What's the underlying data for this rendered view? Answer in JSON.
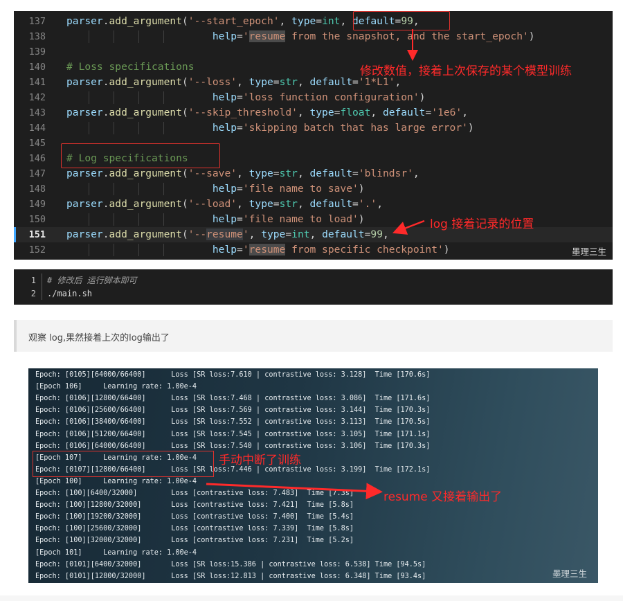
{
  "editor": {
    "lines": [
      {
        "n": "137",
        "parts": [
          [
            "tok-name",
            "parser"
          ],
          [
            "",
            "."
          ],
          [
            "tok-fn",
            "add_argument"
          ],
          [
            "",
            "("
          ],
          [
            "tok-str",
            "'--start_epoch'"
          ],
          [
            "",
            ", "
          ],
          [
            "tok-name",
            "type"
          ],
          [
            "",
            "="
          ],
          [
            "tok-type",
            "int"
          ],
          [
            "",
            ", "
          ],
          [
            "tok-name",
            "default"
          ],
          [
            "",
            "="
          ],
          [
            "tok-num",
            "99"
          ],
          [
            "",
            ","
          ]
        ]
      },
      {
        "n": "138",
        "parts": [
          [
            "",
            "                        "
          ],
          [
            "tok-name",
            "help"
          ],
          [
            "",
            "="
          ],
          [
            "tok-str",
            "'"
          ],
          [
            "tok-str tok-hl2",
            "resume"
          ],
          [
            "tok-str",
            " from the snapshot, and the start_epoch'"
          ],
          [
            "",
            ")"
          ]
        ]
      },
      {
        "n": "139",
        "parts": []
      },
      {
        "n": "140",
        "parts": [
          [
            "tok-cmt",
            "# Loss specifications"
          ]
        ]
      },
      {
        "n": "141",
        "parts": [
          [
            "tok-name",
            "parser"
          ],
          [
            "",
            "."
          ],
          [
            "tok-fn",
            "add_argument"
          ],
          [
            "",
            "("
          ],
          [
            "tok-str",
            "'--loss'"
          ],
          [
            "",
            ", "
          ],
          [
            "tok-name",
            "type"
          ],
          [
            "",
            "="
          ],
          [
            "tok-type",
            "str"
          ],
          [
            "",
            ", "
          ],
          [
            "tok-name",
            "default"
          ],
          [
            "",
            "="
          ],
          [
            "tok-str",
            "'1*L1'"
          ],
          [
            "",
            ","
          ]
        ]
      },
      {
        "n": "142",
        "parts": [
          [
            "",
            "                        "
          ],
          [
            "tok-name",
            "help"
          ],
          [
            "",
            "="
          ],
          [
            "tok-str",
            "'loss function configuration'"
          ],
          [
            "",
            ")"
          ]
        ]
      },
      {
        "n": "143",
        "parts": [
          [
            "tok-name",
            "parser"
          ],
          [
            "",
            "."
          ],
          [
            "tok-fn",
            "add_argument"
          ],
          [
            "",
            "("
          ],
          [
            "tok-str",
            "'--skip_threshold'"
          ],
          [
            "",
            ", "
          ],
          [
            "tok-name",
            "type"
          ],
          [
            "",
            "="
          ],
          [
            "tok-type",
            "float"
          ],
          [
            "",
            ", "
          ],
          [
            "tok-name",
            "default"
          ],
          [
            "",
            "="
          ],
          [
            "tok-str",
            "'1e6'"
          ],
          [
            "",
            ","
          ]
        ]
      },
      {
        "n": "144",
        "parts": [
          [
            "",
            "                        "
          ],
          [
            "tok-name",
            "help"
          ],
          [
            "",
            "="
          ],
          [
            "tok-str",
            "'skipping batch that has large error'"
          ],
          [
            "",
            ")"
          ]
        ]
      },
      {
        "n": "145",
        "parts": []
      },
      {
        "n": "146",
        "parts": [
          [
            "tok-cmt",
            "# Log specifications"
          ]
        ]
      },
      {
        "n": "147",
        "parts": [
          [
            "tok-name",
            "parser"
          ],
          [
            "",
            "."
          ],
          [
            "tok-fn",
            "add_argument"
          ],
          [
            "",
            "("
          ],
          [
            "tok-str",
            "'--save'"
          ],
          [
            "",
            ", "
          ],
          [
            "tok-name",
            "type"
          ],
          [
            "",
            "="
          ],
          [
            "tok-type",
            "str"
          ],
          [
            "",
            ", "
          ],
          [
            "tok-name",
            "default"
          ],
          [
            "",
            "="
          ],
          [
            "tok-str",
            "'blindsr'"
          ],
          [
            "",
            ","
          ]
        ]
      },
      {
        "n": "148",
        "parts": [
          [
            "",
            "                        "
          ],
          [
            "tok-name",
            "help"
          ],
          [
            "",
            "="
          ],
          [
            "tok-str",
            "'file name to save'"
          ],
          [
            "",
            ")"
          ]
        ]
      },
      {
        "n": "149",
        "parts": [
          [
            "tok-name",
            "parser"
          ],
          [
            "",
            "."
          ],
          [
            "tok-fn",
            "add_argument"
          ],
          [
            "",
            "("
          ],
          [
            "tok-str",
            "'--load'"
          ],
          [
            "",
            ", "
          ],
          [
            "tok-name",
            "type"
          ],
          [
            "",
            "="
          ],
          [
            "tok-type",
            "str"
          ],
          [
            "",
            ", "
          ],
          [
            "tok-name",
            "default"
          ],
          [
            "",
            "="
          ],
          [
            "tok-str",
            "'.'"
          ],
          [
            "",
            ","
          ]
        ]
      },
      {
        "n": "150",
        "parts": [
          [
            "",
            "                        "
          ],
          [
            "tok-name",
            "help"
          ],
          [
            "",
            "="
          ],
          [
            "tok-str",
            "'file name to load'"
          ],
          [
            "",
            ")"
          ]
        ]
      },
      {
        "n": "151",
        "current": true,
        "parts": [
          [
            "tok-name",
            "parser"
          ],
          [
            "",
            "."
          ],
          [
            "tok-fn",
            "add_argument"
          ],
          [
            "",
            "("
          ],
          [
            "tok-str",
            "'--"
          ],
          [
            "tok-str tok-hl",
            "resume"
          ],
          [
            "tok-str",
            "'"
          ],
          [
            "",
            ", "
          ],
          [
            "tok-name",
            "type"
          ],
          [
            "",
            "="
          ],
          [
            "tok-type",
            "int"
          ],
          [
            "",
            ", "
          ],
          [
            "tok-name",
            "default"
          ],
          [
            "",
            "="
          ],
          [
            "tok-num",
            "99"
          ],
          [
            "",
            ","
          ]
        ]
      },
      {
        "n": "152",
        "parts": [
          [
            "",
            "                        "
          ],
          [
            "tok-name",
            "help"
          ],
          [
            "",
            "="
          ],
          [
            "tok-str",
            "'"
          ],
          [
            "tok-str tok-hl2",
            "resume"
          ],
          [
            "tok-str",
            " from specific checkpoint'"
          ],
          [
            "",
            ")"
          ]
        ]
      }
    ],
    "annotation_modify": "修改数值，接着上次保存的某个模型训练",
    "annotation_log": "log 接着记录的位置",
    "watermark": "墨理三生"
  },
  "shell": {
    "lines": [
      {
        "n": "1",
        "text": "# 修改后 运行脚本即可",
        "comment": true
      },
      {
        "n": "2",
        "text": "./main.sh",
        "comment": false
      }
    ]
  },
  "quote": {
    "text": "观察 log,果然接着上次的log输出了"
  },
  "terminal": {
    "lines": [
      "Epoch: [0105][64000/66400]      Loss [SR loss:7.610 | contrastive loss: 3.128]  Time [170.6s]",
      "[Epoch 106]     Learning rate: 1.00e-4",
      "Epoch: [0106][12800/66400]      Loss [SR loss:7.468 | contrastive loss: 3.086]  Time [171.6s]",
      "Epoch: [0106][25600/66400]      Loss [SR loss:7.569 | contrastive loss: 3.144]  Time [170.3s]",
      "Epoch: [0106][38400/66400]      Loss [SR loss:7.552 | contrastive loss: 3.113]  Time [170.5s]",
      "Epoch: [0106][51200/66400]      Loss [SR loss:7.545 | contrastive loss: 3.105]  Time [171.1s]",
      "Epoch: [0106][64000/66400]      Loss [SR loss:7.540 | contrastive loss: 3.106]  Time [170.3s]",
      "[Epoch 107]     Learning rate: 1.00e-4",
      "Epoch: [0107][12800/66400]      Loss [SR loss:7.446 | contrastive loss: 3.199]  Time [172.1s]",
      "[Epoch 100]     Learning rate: 1.00e-4",
      "Epoch: [100][6400/32000]        Loss [contrastive loss: 7.483]  Time [7.3s]",
      "Epoch: [100][12800/32000]       Loss [contrastive loss: 7.421]  Time [5.8s]",
      "Epoch: [100][19200/32000]       Loss [contrastive loss: 7.400]  Time [5.4s]",
      "Epoch: [100][25600/32000]       Loss [contrastive loss: 7.339]  Time [5.8s]",
      "Epoch: [100][32000/32000]       Loss [contrastive loss: 7.231]  Time [5.2s]",
      "[Epoch 101]     Learning rate: 1.00e-4",
      "Epoch: [0101][6400/32000]       Loss [SR loss:15.386 | contrastive loss: 6.538] Time [94.5s]",
      "Epoch: [0101][12800/32000]      Loss [SR loss:12.813 | contrastive loss: 6.348] Time [93.4s]"
    ],
    "annotation_interrupt": "手动中断了训练",
    "annotation_resume": "resume 又接着输出了",
    "watermark": "墨理三生"
  }
}
